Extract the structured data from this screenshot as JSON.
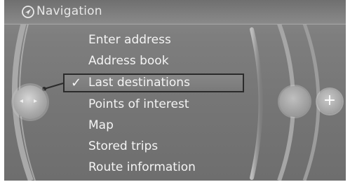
{
  "title_bar": {
    "title": "Navigation",
    "icon": "navigation-icon"
  },
  "menu": {
    "items": [
      {
        "label": "Enter address"
      },
      {
        "label": "Address book"
      },
      {
        "label": "Last destinations",
        "selected": true
      },
      {
        "label": "Points of interest"
      },
      {
        "label": "Map"
      },
      {
        "label": "Stored trips"
      },
      {
        "label": "Route information"
      }
    ],
    "checkmark": "✓"
  },
  "controls": {
    "plus_label": "+",
    "left_arrow": "◂",
    "right_arrow": "▸"
  },
  "colors": {
    "background": "#7a7a7a",
    "text": "#f4f4f4",
    "selection_border": "#2b2b2b"
  }
}
